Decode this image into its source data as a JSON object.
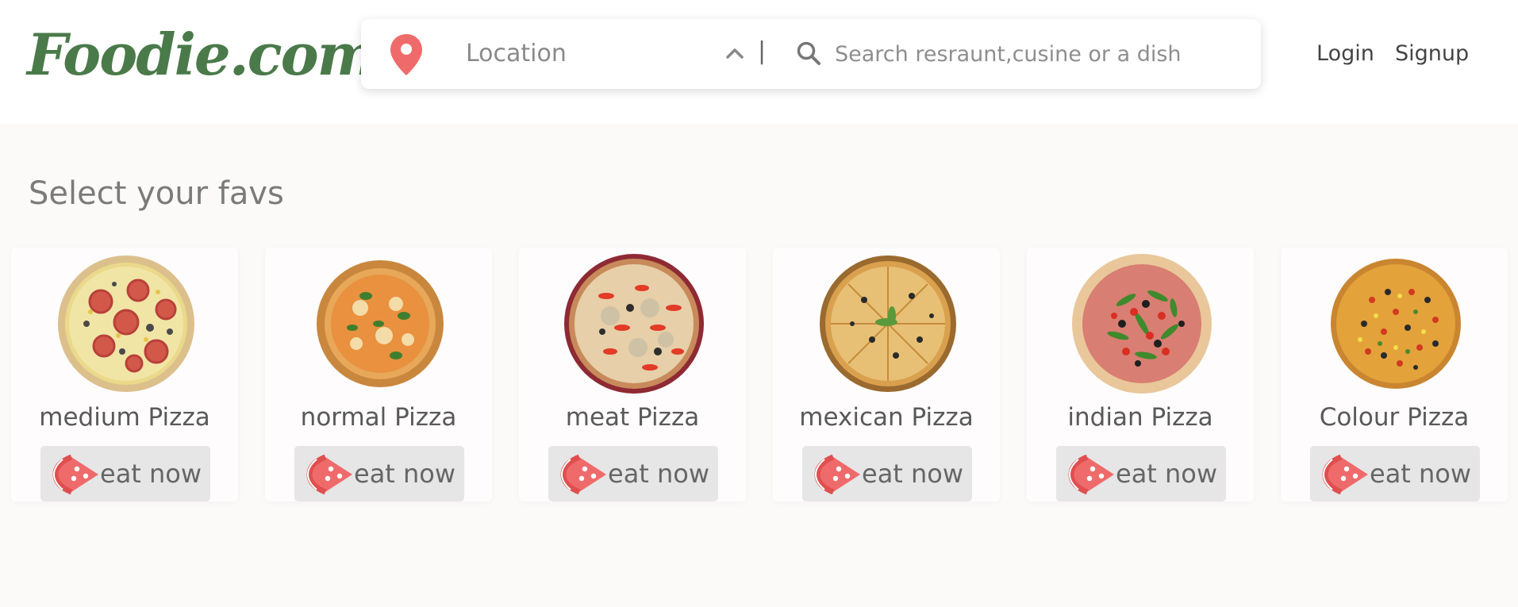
{
  "header": {
    "logo_text": "Foodie.com",
    "search": {
      "location_label": "Location",
      "separator": "|",
      "placeholder": "Search resraunt,cusine or a dish"
    },
    "nav": {
      "login": "Login",
      "signup": "Signup"
    }
  },
  "main": {
    "title": "Select your favs",
    "cards": [
      {
        "name": "medium Pizza",
        "button": "eat now"
      },
      {
        "name": "normal Pizza",
        "button": "eat now"
      },
      {
        "name": "meat Pizza",
        "button": "eat now"
      },
      {
        "name": "mexican Pizza",
        "button": "eat now"
      },
      {
        "name": "indian Pizza",
        "button": "eat now"
      },
      {
        "name": "Colour Pizza",
        "button": "eat now"
      }
    ]
  },
  "colors": {
    "brand_green": "#4a7a49",
    "accent_red": "#ef6b6b",
    "page_background": "#fcf9f9",
    "button_background": "#e6e6e6"
  },
  "icons": [
    "location-pin-icon",
    "chevron-up-icon",
    "search-icon",
    "pizza-slice-icon"
  ]
}
